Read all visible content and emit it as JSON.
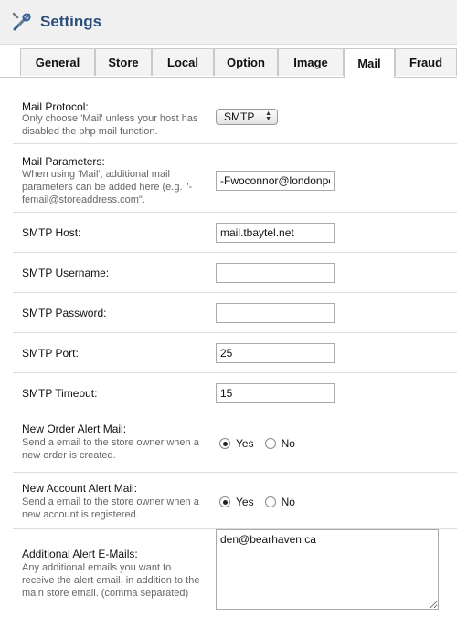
{
  "header": {
    "title": "Settings",
    "icon": "tools-icon"
  },
  "tabs": [
    {
      "label": "General"
    },
    {
      "label": "Store"
    },
    {
      "label": "Local"
    },
    {
      "label": "Option"
    },
    {
      "label": "Image"
    },
    {
      "label": "Mail",
      "active": true
    },
    {
      "label": "Fraud"
    }
  ],
  "form": {
    "mail_protocol": {
      "label": "Mail Protocol:",
      "help": "Only choose 'Mail' unless your host has disabled the php mail function.",
      "value": "SMTP"
    },
    "mail_parameters": {
      "label": "Mail Parameters:",
      "help": "When using 'Mail', additional mail parameters can be added here (e.g. \"-femail@storeaddress.com\".",
      "value": "-Fwoconnor@londonpo"
    },
    "smtp_host": {
      "label": "SMTP Host:",
      "value": "mail.tbaytel.net"
    },
    "smtp_username": {
      "label": "SMTP Username:",
      "value": ""
    },
    "smtp_password": {
      "label": "SMTP Password:",
      "value": ""
    },
    "smtp_port": {
      "label": "SMTP Port:",
      "value": "25"
    },
    "smtp_timeout": {
      "label": "SMTP Timeout:",
      "value": "15"
    },
    "new_order_alert": {
      "label": "New Order Alert Mail:",
      "help": "Send a email to the store owner when a new order is created.",
      "yes": "Yes",
      "no": "No",
      "selected": "Yes"
    },
    "new_account_alert": {
      "label": "New Account Alert Mail:",
      "help": "Send a email to the store owner when a new account is registered.",
      "yes": "Yes",
      "no": "No",
      "selected": "Yes"
    },
    "alert_emails": {
      "label": "Additional Alert E-Mails:",
      "help": "Any additional emails you want to receive the alert email, in addition to the main store email. (comma separated)",
      "value": "den@bearhaven.ca"
    }
  }
}
